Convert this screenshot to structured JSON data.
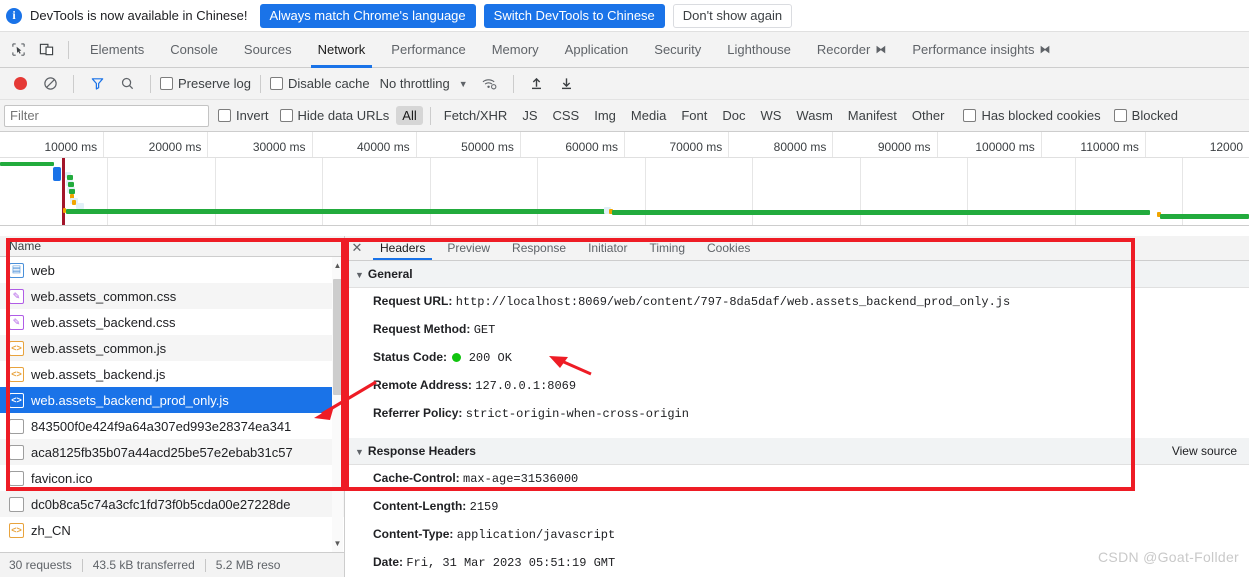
{
  "infobar": {
    "icon": "info-icon",
    "message": "DevTools is now available in Chinese!",
    "buttons": [
      {
        "label": "Always match Chrome's language",
        "style": "primary"
      },
      {
        "label": "Switch DevTools to Chinese",
        "style": "primary"
      },
      {
        "label": "Don't show again",
        "style": "secondary"
      }
    ]
  },
  "tabbar": {
    "inspect_icon": "inspect-cursor-icon",
    "device_icon": "device-toolbar-icon",
    "tabs": [
      {
        "label": "Elements",
        "active": false,
        "flask": false
      },
      {
        "label": "Console",
        "active": false,
        "flask": false
      },
      {
        "label": "Sources",
        "active": false,
        "flask": false
      },
      {
        "label": "Network",
        "active": true,
        "flask": false
      },
      {
        "label": "Performance",
        "active": false,
        "flask": false
      },
      {
        "label": "Memory",
        "active": false,
        "flask": false
      },
      {
        "label": "Application",
        "active": false,
        "flask": false
      },
      {
        "label": "Security",
        "active": false,
        "flask": false
      },
      {
        "label": "Lighthouse",
        "active": false,
        "flask": false
      },
      {
        "label": "Recorder",
        "active": false,
        "flask": true
      },
      {
        "label": "Performance insights",
        "active": false,
        "flask": true
      }
    ],
    "flask_glyph": "⧓"
  },
  "net_toolbar": {
    "record_icon": "record-button",
    "clear_icon": "clear-icon",
    "filter_icon": "filter-funnel-icon",
    "search_icon": "search-icon",
    "preserve_log_label": "Preserve log",
    "preserve_log_checked": false,
    "disable_cache_label": "Disable cache",
    "disable_cache_checked": false,
    "throttling_value": "No throttling",
    "caret_glyph": "▼",
    "wifi_icon": "network-conditions-icon",
    "import_icon": "import-har-icon",
    "export_icon": "export-har-icon"
  },
  "filter_bar": {
    "filter_placeholder": "Filter",
    "filter_value": "",
    "invert_label": "Invert",
    "invert_checked": false,
    "hide_data_urls_label": "Hide data URLs",
    "hide_data_urls_checked": false,
    "types": [
      "All",
      "Fetch/XHR",
      "JS",
      "CSS",
      "Img",
      "Media",
      "Font",
      "Doc",
      "WS",
      "Wasm",
      "Manifest",
      "Other"
    ],
    "selected_type": "All",
    "has_blocked_cookies_label": "Has blocked cookies",
    "has_blocked_cookies_checked": false,
    "blocked_label": "Blocked",
    "blocked_checked": false
  },
  "ruler": {
    "ticks": [
      "10000 ms",
      "20000 ms",
      "30000 ms",
      "40000 ms",
      "50000 ms",
      "60000 ms",
      "70000 ms",
      "80000 ms",
      "90000 ms",
      "100000 ms",
      "110000 ms",
      "12000"
    ]
  },
  "request_list": {
    "header": "Name",
    "rows": [
      {
        "name": "web",
        "icon": "document-icon",
        "type": "doc",
        "selected": false
      },
      {
        "name": "web.assets_common.css",
        "icon": "stylesheet-icon",
        "type": "css",
        "selected": false
      },
      {
        "name": "web.assets_backend.css",
        "icon": "stylesheet-icon",
        "type": "css",
        "selected": false
      },
      {
        "name": "web.assets_common.js",
        "icon": "script-icon",
        "type": "js",
        "selected": false
      },
      {
        "name": "web.assets_backend.js",
        "icon": "script-icon",
        "type": "js",
        "selected": false
      },
      {
        "name": "web.assets_backend_prod_only.js",
        "icon": "script-icon",
        "type": "js",
        "selected": true
      },
      {
        "name": "843500f0e424f9a64a307ed993e28374ea341",
        "icon": "generic-file-icon",
        "type": "plain",
        "selected": false
      },
      {
        "name": "aca8125fb35b07a44acd25be57e2ebab31c57",
        "icon": "generic-file-icon",
        "type": "plain",
        "selected": false
      },
      {
        "name": "favicon.ico",
        "icon": "generic-file-icon",
        "type": "plain",
        "selected": false
      },
      {
        "name": "dc0b8ca5c74a3cfc1fd73f0b5cda00e27228de",
        "icon": "generic-file-icon",
        "type": "plain",
        "selected": false
      },
      {
        "name": "zh_CN",
        "icon": "script-icon",
        "type": "js",
        "selected": false
      }
    ]
  },
  "status_bar": {
    "requests": "30 requests",
    "transferred": "43.5 kB transferred",
    "resources": "5.2 MB reso"
  },
  "details": {
    "close_icon": "close-icon",
    "tabs": [
      {
        "label": "Headers",
        "active": true
      },
      {
        "label": "Preview",
        "active": false
      },
      {
        "label": "Response",
        "active": false
      },
      {
        "label": "Initiator",
        "active": false
      },
      {
        "label": "Timing",
        "active": false
      },
      {
        "label": "Cookies",
        "active": false
      }
    ],
    "general": {
      "title": "General",
      "triangle": "▼",
      "items": [
        {
          "key": "Request URL:",
          "value": "http://localhost:8069/web/content/797-8da5daf/web.assets_backend_prod_only.js",
          "status": false
        },
        {
          "key": "Request Method:",
          "value": "GET",
          "status": false
        },
        {
          "key": "Status Code:",
          "value": "200 OK",
          "status": true
        },
        {
          "key": "Remote Address:",
          "value": "127.0.0.1:8069",
          "status": false
        },
        {
          "key": "Referrer Policy:",
          "value": "strict-origin-when-cross-origin",
          "status": false
        }
      ]
    },
    "response_headers": {
      "title": "Response Headers",
      "triangle": "▼",
      "view_source": "View source",
      "items": [
        {
          "key": "Cache-Control:",
          "value": "max-age=31536000"
        },
        {
          "key": "Content-Length:",
          "value": "2159"
        },
        {
          "key": "Content-Type:",
          "value": "application/javascript"
        },
        {
          "key": "Date:",
          "value": "Fri, 31 Mar 2023 05:51:19 GMT"
        }
      ]
    }
  },
  "annotations": {
    "watermark": "CSDN @Goat-Follder",
    "color": "#ee1c25"
  }
}
